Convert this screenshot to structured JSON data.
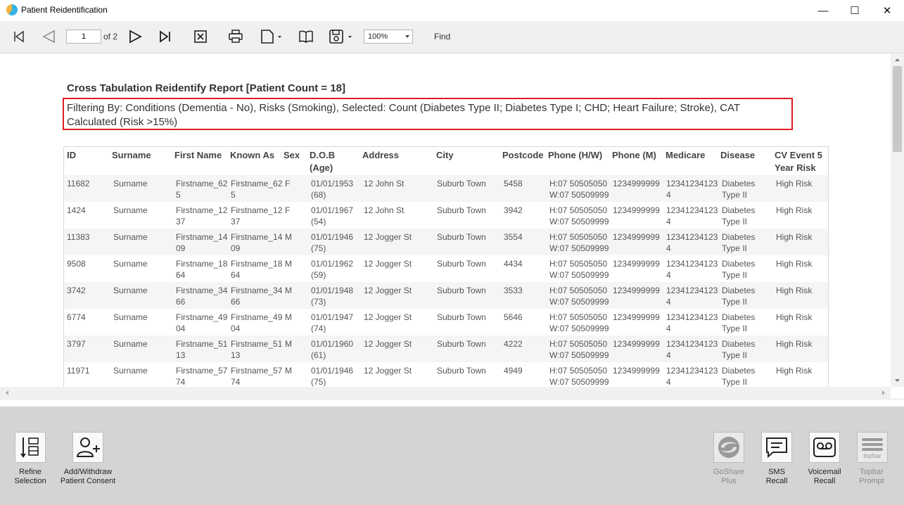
{
  "window": {
    "title": "Patient Reidentification",
    "minimize": "—",
    "maximize": "☐",
    "close": "✕"
  },
  "toolbar": {
    "page_value": "1",
    "page_of": "of 2",
    "zoom": "100%",
    "find_label": "Find"
  },
  "report": {
    "title": "Cross Tabulation Reidentify Report  [Patient Count = 18]",
    "filter_text": "Filtering By: Conditions (Dementia - No), Risks (Smoking), Selected: Count (Diabetes Type II; Diabetes Type I; CHD; Heart Failure; Stroke), CAT Calculated (Risk >15%)",
    "highlight_color": "#e01b24"
  },
  "table": {
    "headers": [
      "ID",
      "Surname",
      "First Name",
      "Known As",
      "Sex",
      "D.O.B\n(Age)",
      "Address",
      "City",
      "Postcode",
      "Phone (H/W)",
      "Phone (M)",
      "Medicare",
      "Disease",
      "CV Event 5\nYear Risk"
    ],
    "rows": [
      [
        "11682",
        "Surname",
        "Firstname_62\n5",
        "Firstname_62\n5",
        "F",
        "01/01/1953\n(68)",
        "12 John St",
        "Suburb Town",
        "5458",
        "H:07 50505050\nW:07 50509999",
        "1234999999",
        "12341234123\n4",
        "Diabetes\nType II",
        "High Risk"
      ],
      [
        "1424",
        "Surname",
        "Firstname_12\n37",
        "Firstname_12\n37",
        "F",
        "01/01/1967\n(54)",
        "12 John St",
        "Suburb Town",
        "3942",
        "H:07 50505050\nW:07 50509999",
        "1234999999",
        "12341234123\n4",
        "Diabetes\nType II",
        "High Risk"
      ],
      [
        "11383",
        "Surname",
        "Firstname_14\n09",
        "Firstname_14\n09",
        "M",
        "01/01/1946\n(75)",
        "12 Jogger St",
        "Suburb Town",
        "3554",
        "H:07 50505050\nW:07 50509999",
        "1234999999",
        "12341234123\n4",
        "Diabetes\nType II",
        "High Risk"
      ],
      [
        "9508",
        "Surname",
        "Firstname_18\n64",
        "Firstname_18\n64",
        "M",
        "01/01/1962\n(59)",
        "12 Jogger St",
        "Suburb Town",
        "4434",
        "H:07 50505050\nW:07 50509999",
        "1234999999",
        "12341234123\n4",
        "Diabetes\nType II",
        "High Risk"
      ],
      [
        "3742",
        "Surname",
        "Firstname_34\n66",
        "Firstname_34\n66",
        "M",
        "01/01/1948\n(73)",
        "12 Jogger St",
        "Suburb Town",
        "3533",
        "H:07 50505050\nW:07 50509999",
        "1234999999",
        "12341234123\n4",
        "Diabetes\nType II",
        "High Risk"
      ],
      [
        "6774",
        "Surname",
        "Firstname_49\n04",
        "Firstname_49\n04",
        "M",
        "01/01/1947\n(74)",
        "12 Jogger St",
        "Suburb Town",
        "5646",
        "H:07 50505050\nW:07 50509999",
        "1234999999",
        "12341234123\n4",
        "Diabetes\nType II",
        "High Risk"
      ],
      [
        "3797",
        "Surname",
        "Firstname_51\n13",
        "Firstname_51\n13",
        "M",
        "01/01/1960\n(61)",
        "12 Jogger St",
        "Suburb Town",
        "4222",
        "H:07 50505050\nW:07 50509999",
        "1234999999",
        "12341234123\n4",
        "Diabetes\nType II",
        "High Risk"
      ],
      [
        "11971",
        "Surname",
        "Firstname_57\n74",
        "Firstname_57\n74",
        "M",
        "01/01/1946\n(75)",
        "12 Jogger St",
        "Suburb Town",
        "4949",
        "H:07 50505050\nW:07 50509999",
        "1234999999",
        "12341234123\n4",
        "Diabetes\nType II",
        "High Risk"
      ]
    ]
  },
  "bottom_actions": {
    "refine": "Refine\nSelection",
    "consent": "Add/Withdraw\nPatient Consent",
    "goshare": "GoShare\nPlus",
    "sms": "SMS\nRecall",
    "voicemail": "Voicemail\nRecall",
    "topbar": "Topbar\nPrompt",
    "topbar_logo_text": "topbar"
  }
}
